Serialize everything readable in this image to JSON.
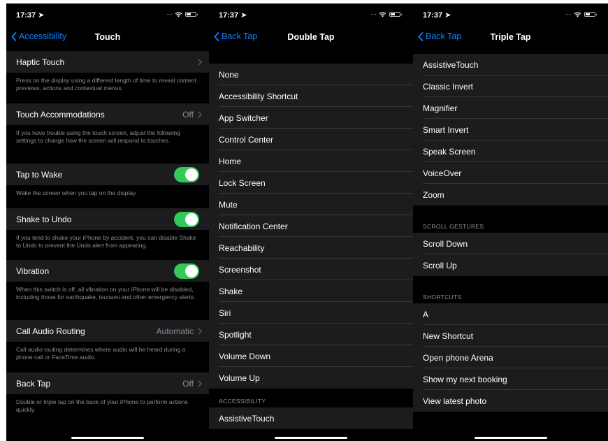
{
  "touch": {
    "status_time": "17:37 ➤",
    "back_label": "Accessibility",
    "title": "Touch",
    "haptic_label": "Haptic Touch",
    "haptic_footer": "Press on the display using a different length of time to reveal content previews, actions and contextual menus.",
    "accommodations_label": "Touch Accommodations",
    "accommodations_value": "Off",
    "accommodations_footer": "If you have trouble using the touch screen, adjust the following settings to change how the screen will respond to touches.",
    "tap_to_wake_label": "Tap to Wake",
    "tap_to_wake_on": true,
    "tap_to_wake_footer": "Wake the screen when you tap on the display.",
    "shake_label": "Shake to Undo",
    "shake_on": true,
    "shake_footer": "If you tend to shake your iPhone by accident, you can disable Shake to Undo to prevent the Undo alert from appearing.",
    "vibration_label": "Vibration",
    "vibration_on": true,
    "vibration_footer": "When this switch is off, all vibration on your iPhone will be disabled, including those for earthquake, tsunami and other emergency alerts.",
    "call_audio_label": "Call Audio Routing",
    "call_audio_value": "Automatic",
    "call_audio_footer": "Call audio routing determines where audio will be heard during a phone call or FaceTime audio.",
    "back_tap_label": "Back Tap",
    "back_tap_value": "Off",
    "back_tap_footer": "Double or triple tap on the back of your iPhone to perform actions quickly."
  },
  "double": {
    "status_time": "17:37 ➤",
    "back_label": "Back Tap",
    "title": "Double Tap",
    "items": [
      "None",
      "Accessibility Shortcut",
      "App Switcher",
      "Control Center",
      "Home",
      "Lock Screen",
      "Mute",
      "Notification Center",
      "Reachability",
      "Screenshot",
      "Shake",
      "Siri",
      "Spotlight",
      "Volume Down",
      "Volume Up"
    ],
    "accessibility_header": "ACCESSIBILITY",
    "accessibility_items": [
      "AssistiveTouch"
    ]
  },
  "triple": {
    "status_time": "17:37 ➤",
    "back_label": "Back Tap",
    "title": "Triple Tap",
    "items": [
      "AssistiveTouch",
      "Classic Invert",
      "Magnifier",
      "Smart Invert",
      "Speak Screen",
      "VoiceOver",
      "Zoom"
    ],
    "scroll_header": "SCROLL GESTURES",
    "scroll_items": [
      "Scroll Down",
      "Scroll Up"
    ],
    "shortcuts_header": "SHORTCUTS",
    "shortcut_items": [
      "A",
      "New Shortcut",
      "Open phone Arena",
      "Show my next booking",
      "View latest photo"
    ]
  },
  "colors": {
    "accent": "#0a84ff",
    "toggle_on": "#34c759",
    "cell_bg": "#1c1c1e",
    "page_bg": "#000000",
    "secondary_text": "#8e8e93"
  }
}
